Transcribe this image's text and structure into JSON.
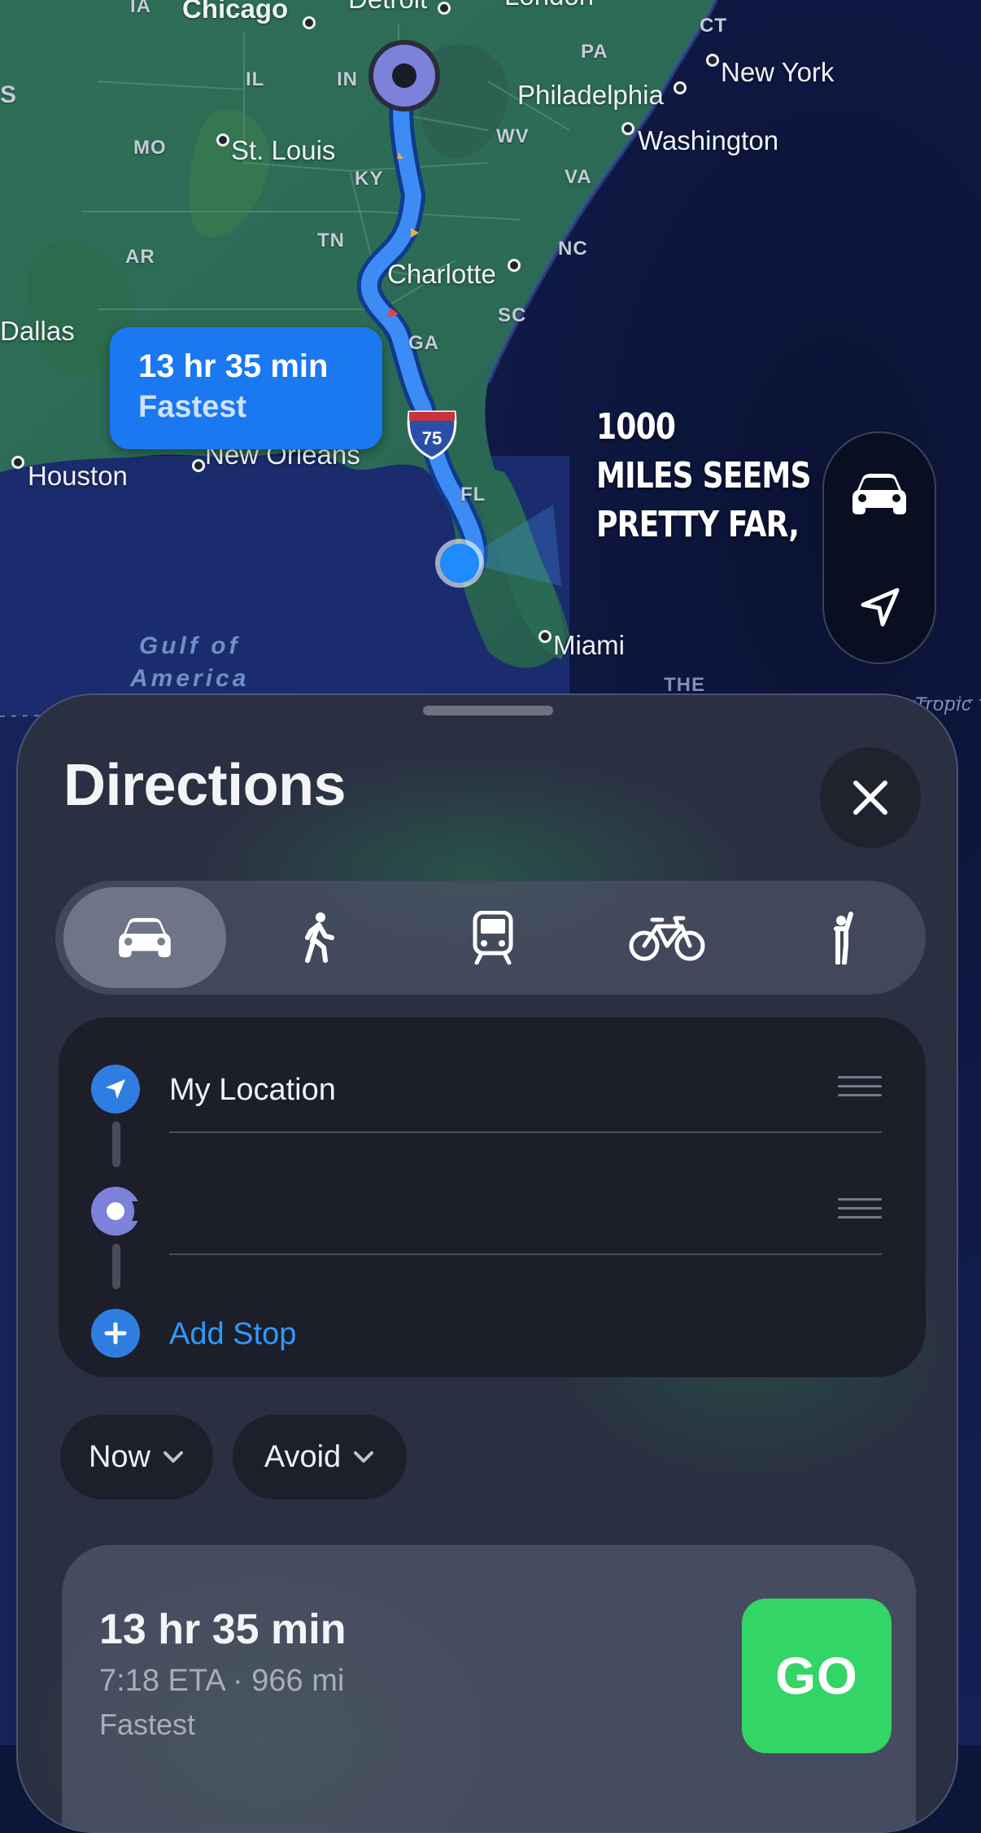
{
  "map": {
    "cities": {
      "chicago": "Chicago",
      "detroit": "Detroit",
      "london": "London",
      "new_york": "New York",
      "philadelphia": "Philadelphia",
      "washington": "Washington",
      "st_louis": "St. Louis",
      "charlotte": "Charlotte",
      "dallas": "Dallas",
      "houston": "Houston",
      "new_orleans": "New Orleans",
      "miami": "Miami"
    },
    "states": {
      "ia": "IA",
      "il": "IL",
      "in": "IN",
      "pa": "PA",
      "ct": "CT",
      "mo": "MO",
      "ky": "KY",
      "wv": "WV",
      "va": "VA",
      "tn": "TN",
      "nc": "NC",
      "ar": "AR",
      "sc": "SC",
      "ga": "GA",
      "fl": "FL",
      "s": "S"
    },
    "water": {
      "gulf_line1": "Gulf of",
      "gulf_line2": "America",
      "the": "THE",
      "tropic": "Tropic"
    },
    "interstate": "75",
    "route_bubble": {
      "time": "13 hr 35 min",
      "label": "Fastest"
    }
  },
  "overlay_caption": {
    "line1": "1000",
    "line2": "MILES SEEMS",
    "line3": "PRETTY FAR,"
  },
  "sheet": {
    "title": "Directions",
    "modes": [
      {
        "name": "Drive",
        "icon": "car-icon",
        "active": true
      },
      {
        "name": "Walk",
        "icon": "walking-icon"
      },
      {
        "name": "Transit",
        "icon": "train-icon"
      },
      {
        "name": "Cycle",
        "icon": "bicycle-icon"
      },
      {
        "name": "Ride",
        "icon": "rideshare-icon"
      }
    ],
    "stops": {
      "origin": "My Location",
      "destination": "",
      "add_stop": "Add Stop"
    },
    "options": {
      "now": "Now",
      "avoid": "Avoid"
    },
    "route": {
      "time": "13 hr 35 min",
      "eta": "7:18 ETA · 966 mi",
      "tag": "Fastest",
      "go": "GO"
    }
  },
  "colors": {
    "accent_blue": "#1a78f0",
    "go_green": "#34d567",
    "route_line": "#3d8cf6"
  }
}
